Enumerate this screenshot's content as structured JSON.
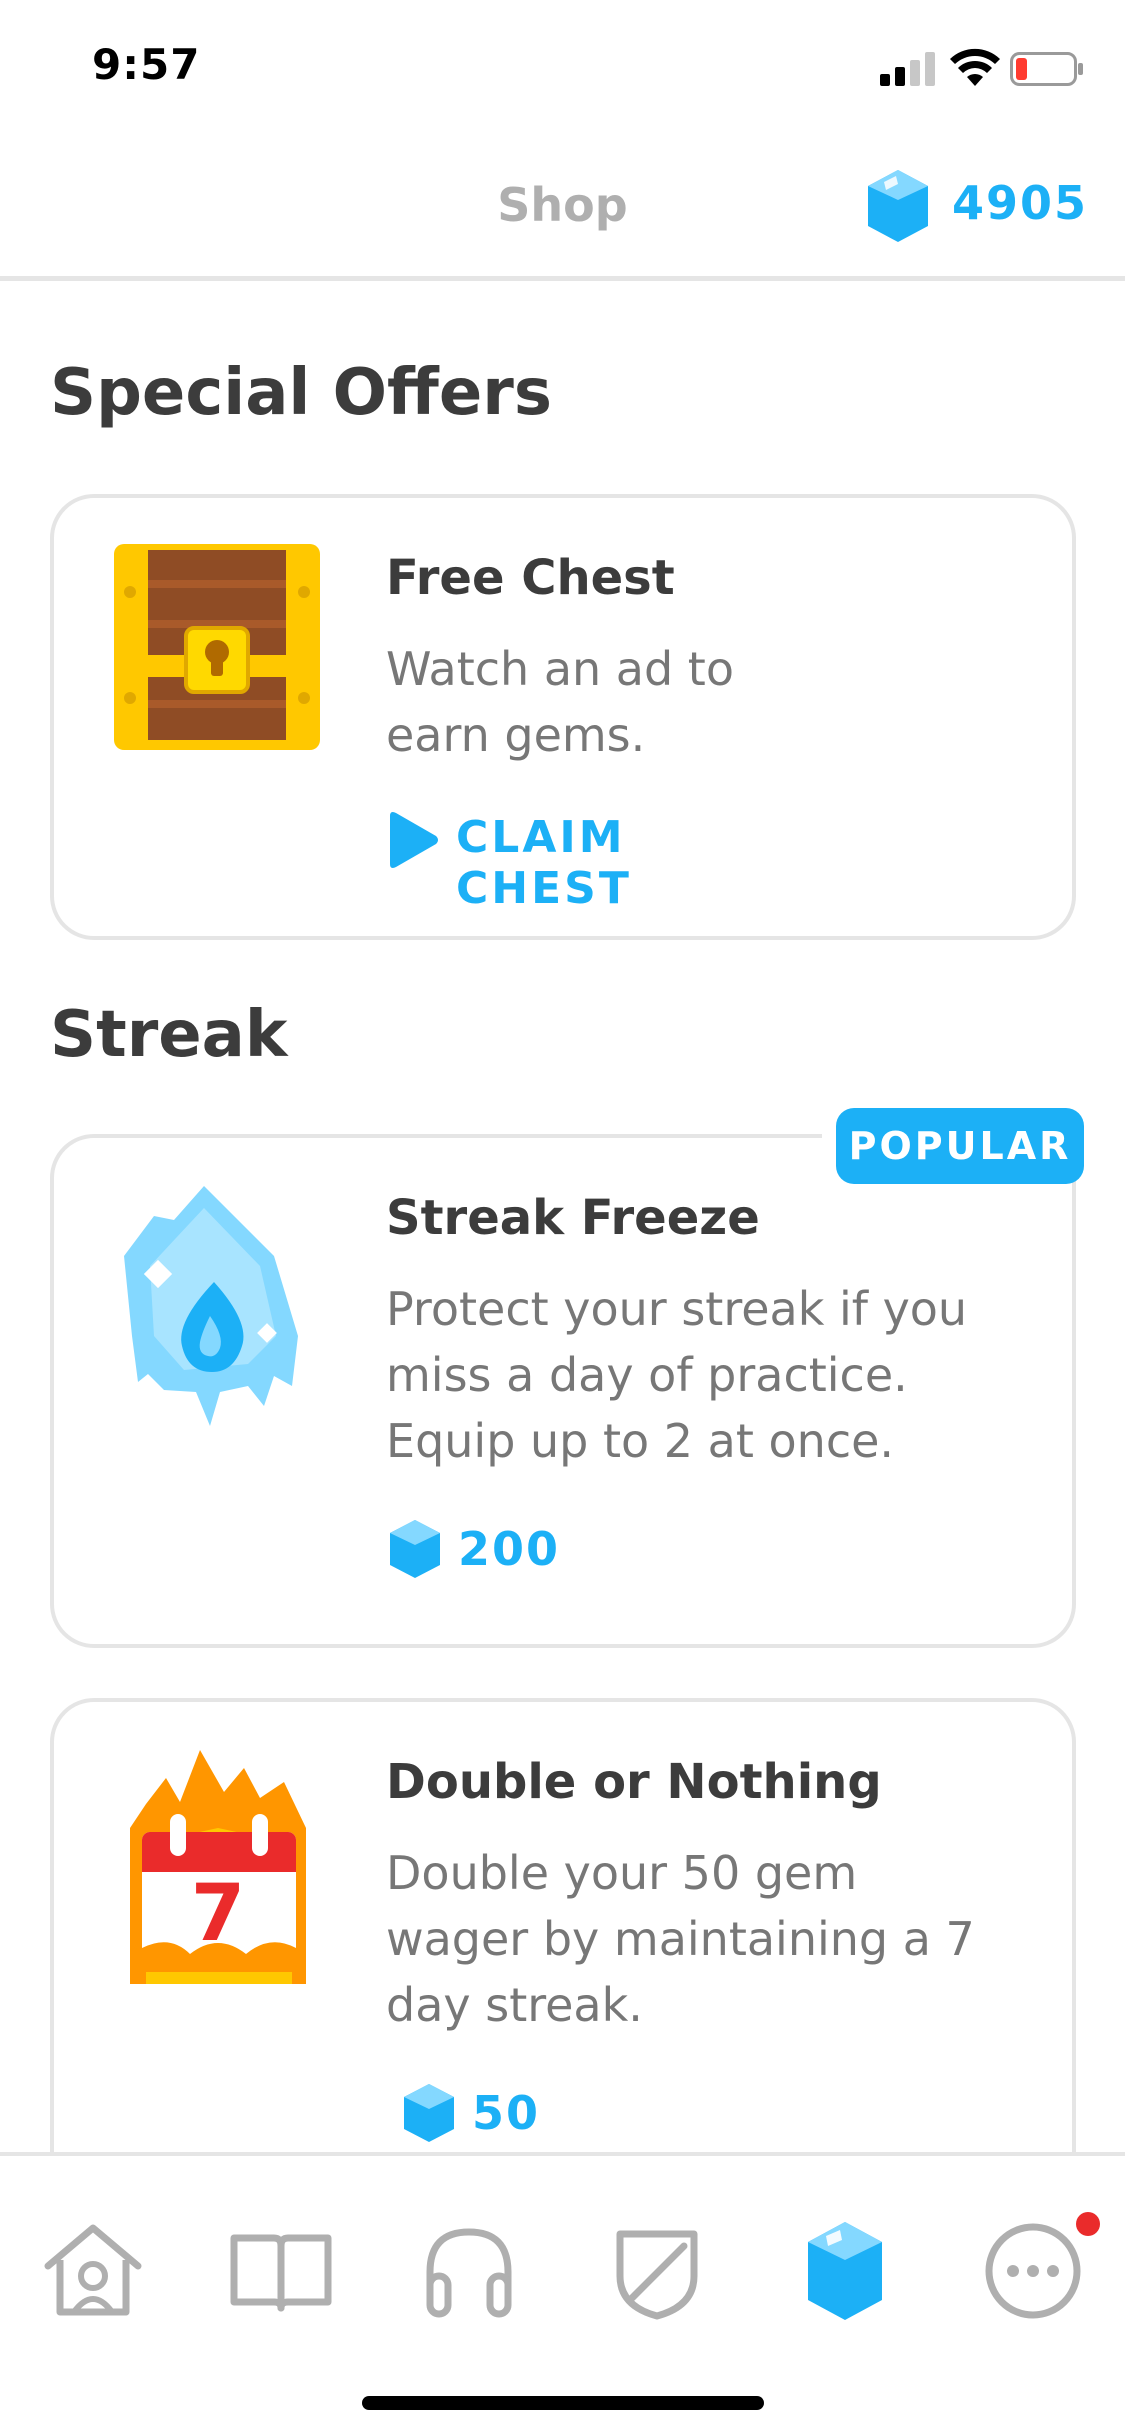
{
  "status_bar": {
    "time": "9:57"
  },
  "header": {
    "title": "Shop",
    "gem_count": "4905"
  },
  "special_offers": {
    "title": "Special Offers",
    "free_chest": {
      "title": "Free Chest",
      "desc_line1": "Watch an ad to",
      "desc_line2": "earn gems.",
      "action": "CLAIM CHEST"
    }
  },
  "streak": {
    "title": "Streak",
    "streak_freeze": {
      "badge": "POPULAR",
      "title": "Streak Freeze",
      "desc_line1": "Protect your streak if you",
      "desc_line2": "miss a day of practice.",
      "desc_line3": "Equip up to 2 at once.",
      "price": "200"
    },
    "double_or_nothing": {
      "title": "Double or Nothing",
      "desc_line1": "Double your 50 gem",
      "desc_line2": "wager by maintaining a 7",
      "desc_line3": "day streak.",
      "calendar_number": "7",
      "price": "50"
    }
  },
  "nav": {
    "items": [
      {
        "name": "home",
        "active": false
      },
      {
        "name": "stories",
        "active": false
      },
      {
        "name": "listening",
        "active": false
      },
      {
        "name": "leaderboards",
        "active": false
      },
      {
        "name": "shop",
        "active": true
      },
      {
        "name": "more",
        "active": false,
        "notification": true
      }
    ]
  },
  "colors": {
    "accent": "#1cb0f6",
    "border": "#e5e5e5",
    "nav_inactive": "#afafaf",
    "notification": "#ea2b2b"
  }
}
